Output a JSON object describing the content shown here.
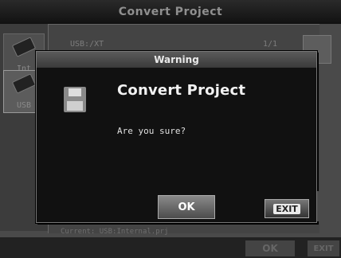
{
  "window": {
    "title": "Convert Project"
  },
  "sidebar": {
    "tabs": [
      {
        "label": "Int"
      },
      {
        "label": "USB"
      }
    ]
  },
  "browser": {
    "path": "USB:/XT",
    "page": "1/1"
  },
  "status": {
    "current": "Current: USB:Internal.prj"
  },
  "bottom_bar": {
    "ok_label": "OK",
    "exit_label": "EXIT"
  },
  "dialog": {
    "title": "Warning",
    "heading": "Convert Project",
    "message": "Are you sure?",
    "ok_label": "OK",
    "exit_label": "EXIT",
    "icon": "floppy-disk-icon"
  }
}
